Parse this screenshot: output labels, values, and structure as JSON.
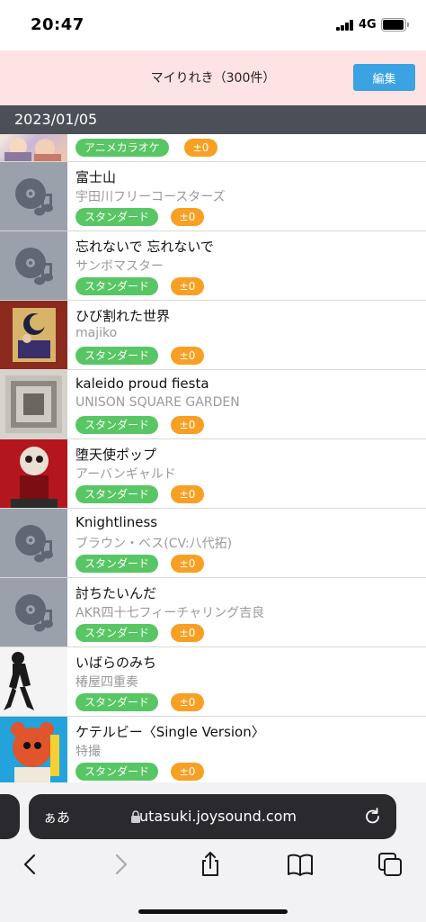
{
  "status": {
    "time": "20:47",
    "network": "4G"
  },
  "header": {
    "title": "マイりれき（300件）",
    "edit_label": "編集"
  },
  "date": "2023/01/05",
  "rows": [
    {
      "title": "",
      "artist": "",
      "tag": "アニメカラオケ",
      "key": "±0",
      "thumb": "anime-thumbnail"
    },
    {
      "title": "富士山",
      "artist": "宇田川フリーコースターズ",
      "tag": "スタンダード",
      "key": "±0",
      "thumb": "music-disc-icon"
    },
    {
      "title": "忘れないで 忘れないで",
      "artist": "サンボマスター",
      "tag": "スタンダード",
      "key": "±0",
      "thumb": "music-disc-icon"
    },
    {
      "title": "ひび割れた世界",
      "artist": "majiko",
      "tag": "スタンダード",
      "key": "±0",
      "thumb": "album-art"
    },
    {
      "title": "kaleido proud fiesta",
      "artist": "UNISON SQUARE GARDEN",
      "tag": "スタンダード",
      "key": "±0",
      "thumb": "album-art"
    },
    {
      "title": "堕天使ポップ",
      "artist": "アーバンギャルド",
      "tag": "スタンダード",
      "key": "±0",
      "thumb": "album-art"
    },
    {
      "title": "Knightliness",
      "artist": "ブラウン・ベス(CV:八代拓)",
      "tag": "スタンダード",
      "key": "±0",
      "thumb": "music-disc-icon"
    },
    {
      "title": "討ちたいんだ",
      "artist": "AKR四十七フィーチャリング吉良",
      "tag": "スタンダード",
      "key": "±0",
      "thumb": "music-disc-icon"
    },
    {
      "title": "いばらのみち",
      "artist": "椿屋四重奏",
      "tag": "スタンダード",
      "key": "±0",
      "thumb": "album-art"
    },
    {
      "title": "ケテルビー〈Single Version〉",
      "artist": "特撮",
      "tag": "スタンダード",
      "key": "±0",
      "thumb": "album-art"
    }
  ],
  "browser": {
    "aa": "ぁあ",
    "url": "utasuki.joysound.com"
  },
  "colors": {
    "header_bg": "#fde3e4",
    "edit_button": "#3ba3e2",
    "date_bar": "#4b5058",
    "tag_green": "#58c664",
    "key_orange": "#f7a023"
  }
}
